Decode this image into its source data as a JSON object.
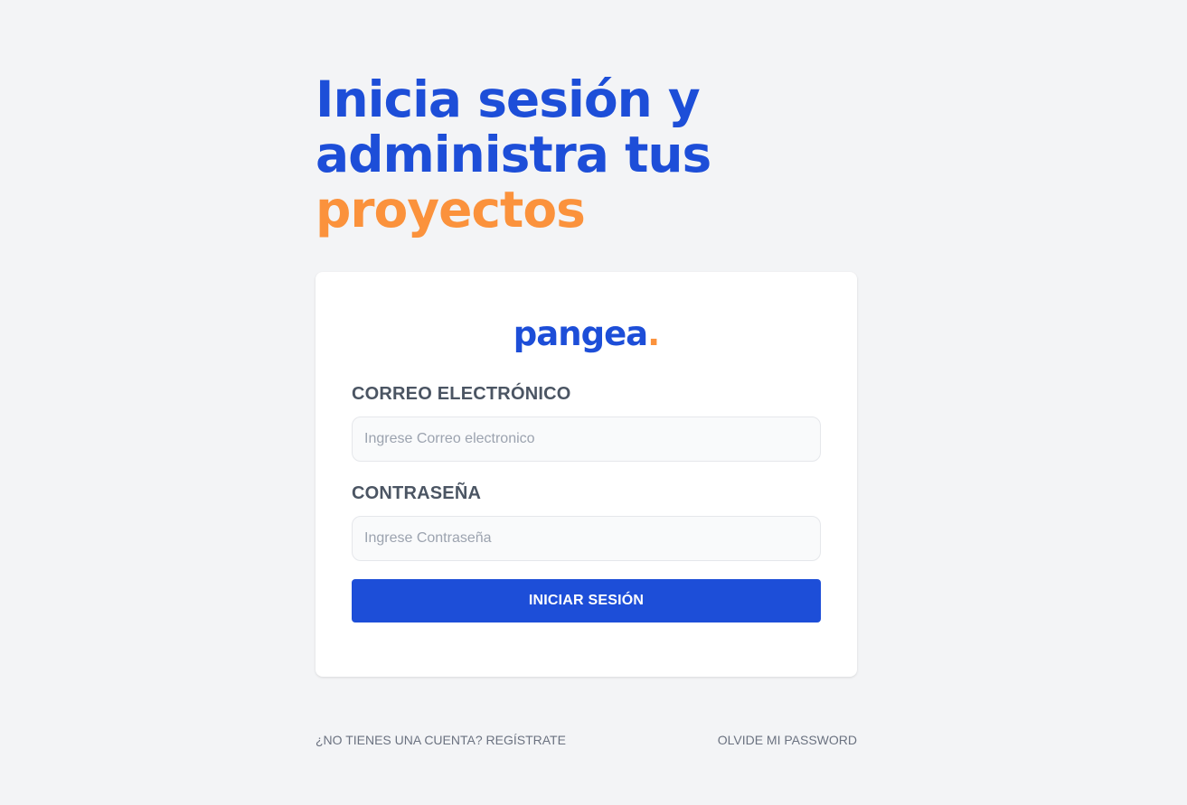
{
  "headline": {
    "line1": "Inicia sesión y",
    "line2": "administra tus",
    "accent": "proyectos"
  },
  "logo": {
    "text": "pangea",
    "dot": "."
  },
  "form": {
    "email_label": "CORREO ELECTRÓNICO",
    "email_placeholder": "Ingrese Correo electronico",
    "password_label": "CONTRASEÑA",
    "password_placeholder": "Ingrese Contraseña",
    "submit_label": "INICIAR SESIÓN"
  },
  "footer": {
    "register_link": "¿NO TIENES UNA CUENTA? REGÍSTRATE",
    "forgot_link": "OLVIDE MI PASSWORD"
  },
  "colors": {
    "primary": "#1d4ed8",
    "accent": "#fb923c",
    "background": "#f3f4f6"
  }
}
